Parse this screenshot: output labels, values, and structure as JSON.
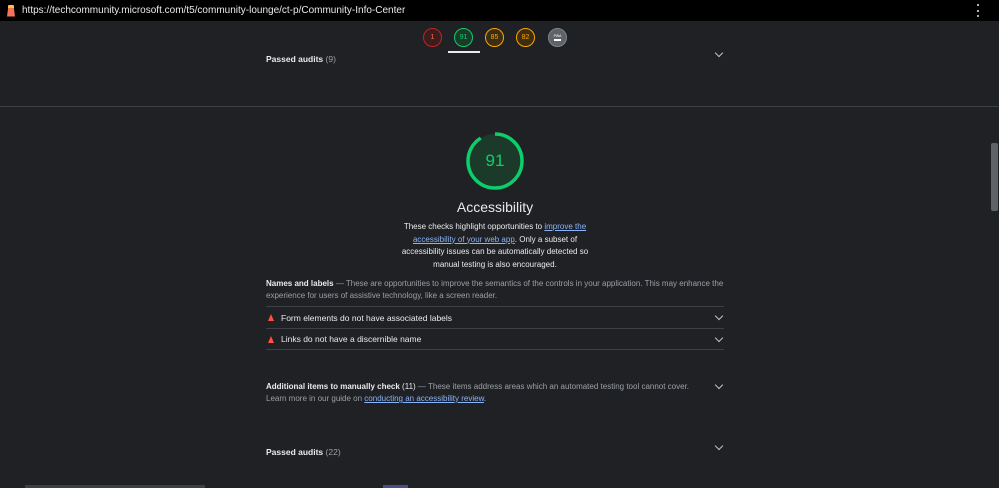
{
  "browser": {
    "url": "https://techcommunity.microsoft.com/t5/community-lounge/ct-p/Community-Info-Center"
  },
  "score_gauges": [
    {
      "label": "1",
      "color": "#ff6d5a"
    },
    {
      "label": "91",
      "color": "#0cce6b"
    },
    {
      "label": "85",
      "color": "#ffa400"
    },
    {
      "label": "82",
      "color": "#ffa400"
    },
    {
      "label": "PWA",
      "color": "#9aa0a6"
    }
  ],
  "prev_section": {
    "passed_title": "Passed audits",
    "passed_count": "(9)"
  },
  "category": {
    "score": "91",
    "score_fraction": 0.91,
    "title": "Accessibility",
    "desc_before": "These checks highlight opportunities to ",
    "desc_link": "improve the accessibility of your web app",
    "desc_after": ". Only a subset of accessibility issues can be automatically detected so manual testing is also encouraged."
  },
  "names_labels": {
    "title": "Names and labels",
    "desc": " — These are opportunities to improve the semantics of the controls in your application. This may enhance the experience for users of assistive technology, like a screen reader."
  },
  "audits": [
    {
      "label": "Form elements do not have associated labels"
    },
    {
      "label": "Links do not have a discernible name"
    }
  ],
  "manual": {
    "title": "Additional items to manually check",
    "count": "(11)",
    "desc": " — These items address areas which an automated testing tool cannot cover. Learn more in our guide on ",
    "link": "conducting an accessibility review",
    "end": "."
  },
  "passed": {
    "title": "Passed audits",
    "count": "(22)"
  },
  "colors": {
    "pass": "#0cce6b",
    "average": "#ffa400",
    "fail": "#ff4e42",
    "link": "#8ab4f8"
  }
}
